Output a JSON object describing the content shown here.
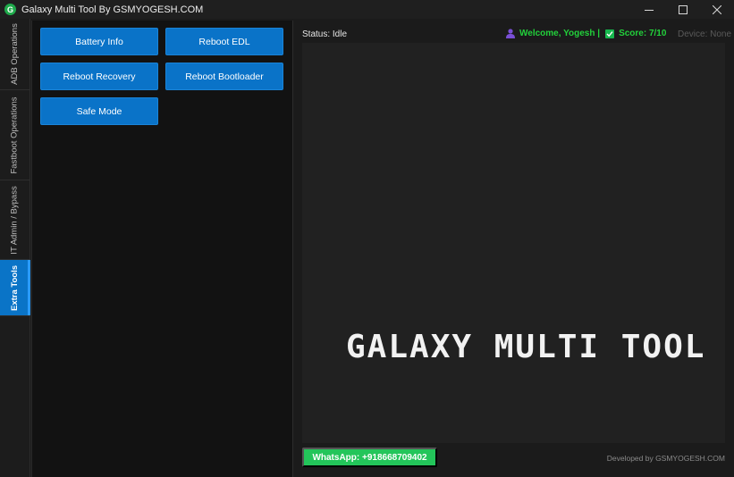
{
  "window": {
    "logo_letter": "G",
    "title": "Galaxy Multi Tool By GSMYOGESH.COM",
    "controls": [
      "minimize-icon",
      "maximize-icon",
      "close-icon"
    ]
  },
  "tabs": [
    {
      "label": "ADB Operations",
      "active": false
    },
    {
      "label": "Fastboot Operations",
      "active": false
    },
    {
      "label": "IT Admin / Bypass",
      "active": false
    },
    {
      "label": "Extra Tools",
      "active": true
    }
  ],
  "actions": {
    "battery_info": "Battery Info",
    "reboot_edl": "Reboot EDL",
    "reboot_recovery": "Reboot Recovery",
    "reboot_bootloader": "Reboot Bootloader",
    "safe_mode": "Safe Mode"
  },
  "status": {
    "text": "Status: Idle",
    "welcome": "Welcome, Yogesh |",
    "score": "Score: 7/10",
    "device": "Device: None"
  },
  "banner": "GALAXY MULTI TOOL",
  "footer": {
    "whatsapp": "WhatsApp: +918668709402",
    "developer": "Developed by GSMYOGESH.COM"
  },
  "colors": {
    "accent": "#0a73c8",
    "highlight": "#22d13b",
    "whatsapp": "#23c55a"
  }
}
